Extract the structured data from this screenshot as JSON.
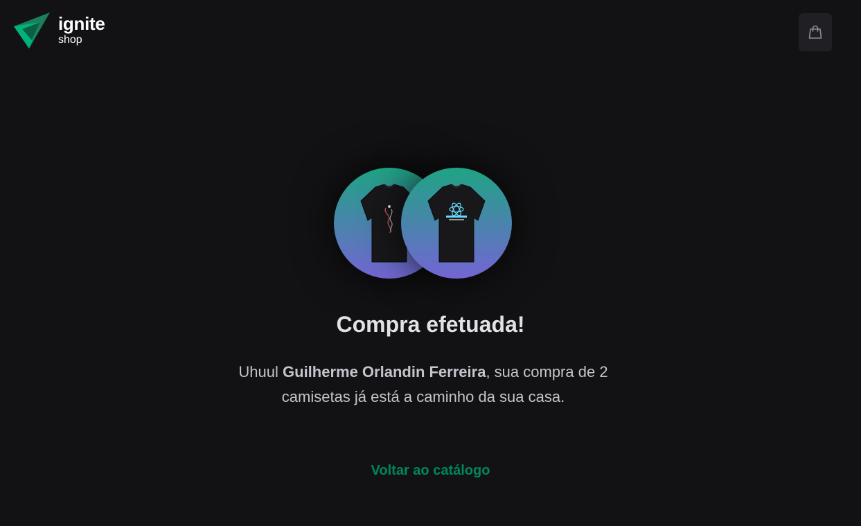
{
  "brand": {
    "title": "ignite",
    "subtitle": "shop",
    "accent_color": "#00875f",
    "gradient": [
      "#1ea483",
      "#7465d4"
    ]
  },
  "header": {
    "cart_icon": "shopping-bag-icon"
  },
  "products": [
    {
      "name": "t-shirt-1",
      "icon": "t-shirt-icon"
    },
    {
      "name": "t-shirt-2",
      "icon": "t-shirt-icon"
    }
  ],
  "success": {
    "title": "Compra efetuada!",
    "greeting": "Uhuul ",
    "customer_name": "Guilherme Orlandin Ferreira",
    "message_rest": ", sua compra de 2 camisetas já está a caminho da sua casa.",
    "back_link": "Voltar ao catálogo"
  }
}
